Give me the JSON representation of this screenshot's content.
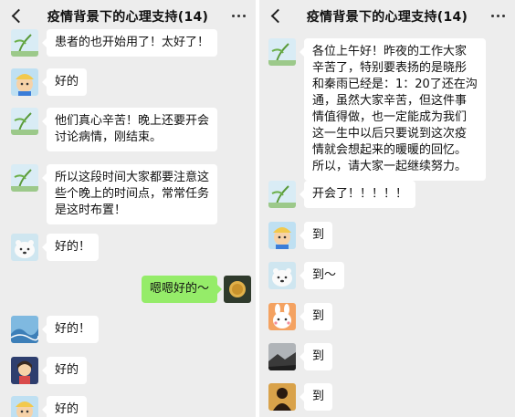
{
  "chat_title": "疫情背景下的心理支持(14)",
  "left": {
    "messages": [
      {
        "text": "患者的也开始用了！太好了！",
        "avatar": "plant-avatar"
      },
      {
        "text": "好的",
        "avatar": "cartoon-kid-avatar"
      },
      {
        "text": "他们真心辛苦！晚上还要开会\n讨论病情，刚结束。",
        "avatar": "plant-avatar"
      },
      {
        "text": "所以这段时间大家都要注意这\n些个晚上的时间点，常常任务\n是这时布置！",
        "avatar": "plant-avatar"
      },
      {
        "text": "好的！",
        "avatar": "polar-bear-avatar"
      },
      {
        "text": "嗯嗯好的～",
        "avatar": "coin-avatar",
        "self": true
      },
      {
        "text": "好的！",
        "avatar": "wave-avatar"
      },
      {
        "text": "好的",
        "avatar": "cartoon-girl-avatar"
      },
      {
        "text": "好的",
        "avatar": "cartoon-kid-avatar"
      }
    ]
  },
  "right": {
    "messages": [
      {
        "text": "各位上午好！昨夜的工作大家\n辛苦了，特别要表扬的是晓彤\n和秦雨已经是：1：20了还在沟\n通，虽然大家辛苦，但这件事\n情值得做，也一定能成为我们\n这一生中以后只要说到这次疫\n情就会想起来的暖暖的回忆。\n所以，请大家一起继续努力。",
        "avatar": "plant-avatar"
      },
      {
        "text": "开会了！！！！！",
        "avatar": "plant-avatar"
      },
      {
        "text": "到",
        "avatar": "cartoon-kid-avatar"
      },
      {
        "text": "到～",
        "avatar": "polar-bear-avatar"
      },
      {
        "text": "到",
        "avatar": "bunny-avatar"
      },
      {
        "text": "到",
        "avatar": "dark-landscape-avatar"
      },
      {
        "text": "到",
        "avatar": "silhouette-avatar"
      }
    ]
  },
  "colors": {
    "background": "#ededed",
    "bubble_self": "#95ec69",
    "bubble_other": "#ffffff"
  }
}
